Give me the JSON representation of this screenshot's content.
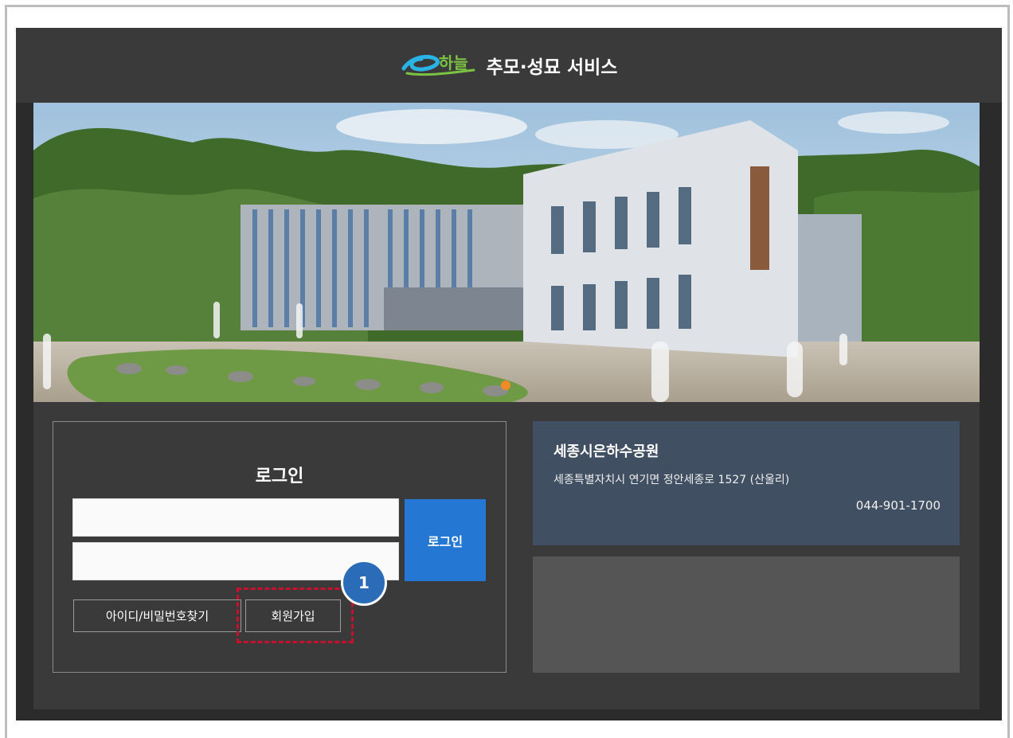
{
  "header": {
    "logo_text": "e하늘",
    "title": "추모·성묘 서비스"
  },
  "banner": {
    "description_icon": "building-photo"
  },
  "login": {
    "title": "로그인",
    "id_value": "",
    "password_value": "",
    "login_button": "로그인",
    "find_account_button": "아이디/비밀번호찾기",
    "signup_button": "회원가입",
    "annotation_number": "1"
  },
  "facility": {
    "name": "세종시은하수공원",
    "address": "세종특별자치시 연기면 정안세종로 1527 (산울리)",
    "phone": "044-901-1700"
  },
  "colors": {
    "header_bg": "#3a3a3a",
    "accent_blue": "#2477d2",
    "info_card_bg": "#404f62",
    "annotation_red": "#c8102e",
    "badge_blue": "#2b6cb8"
  }
}
